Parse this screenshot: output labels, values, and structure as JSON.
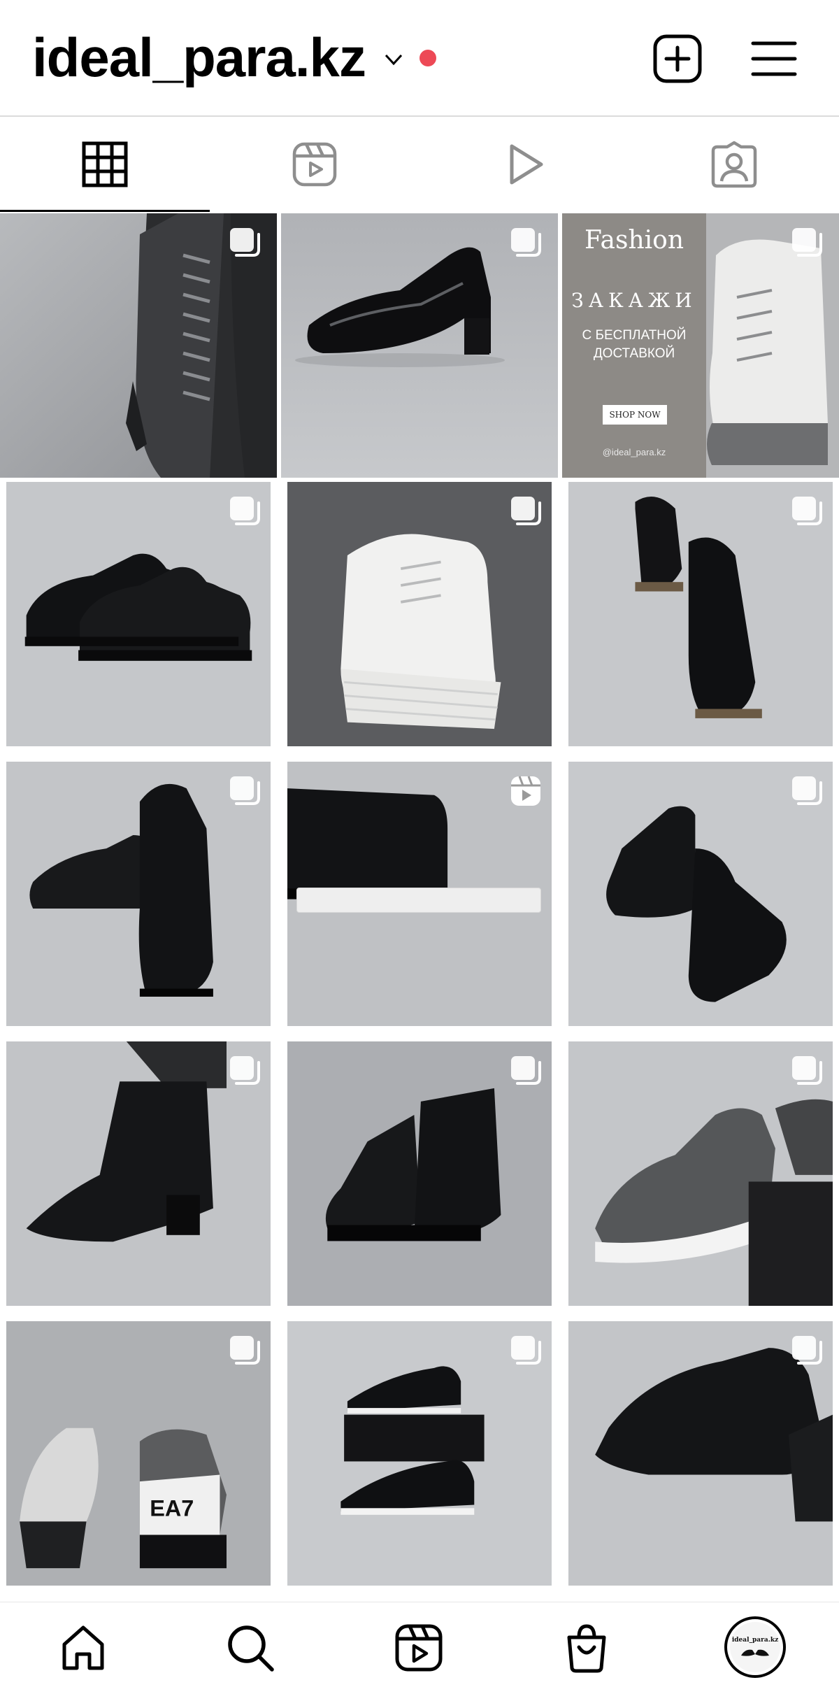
{
  "profile": {
    "username": "ideal_para.kz",
    "has_notification_dot": true,
    "notification_color": "#ed4956"
  },
  "header": {
    "icons": [
      "chevron-down-icon",
      "create-post-icon",
      "menu-icon"
    ]
  },
  "tabs": [
    {
      "name": "posts",
      "icon": "grid-icon",
      "active": true
    },
    {
      "name": "reels",
      "icon": "reels-icon",
      "active": false
    },
    {
      "name": "videos",
      "icon": "play-icon",
      "active": false
    },
    {
      "name": "tagged",
      "icon": "tagged-user-icon",
      "active": false
    }
  ],
  "grid": {
    "posts": [
      {
        "type": "carousel",
        "subject": "black leather lace-up heeled boots"
      },
      {
        "type": "carousel",
        "subject": "black patent leather heeled pumps"
      },
      {
        "type": "carousel",
        "subject": "promo banner with white platform boots",
        "promo": {
          "title": "Fashion",
          "headline": "ЗАКАЖИ",
          "subtitle": "С БЕСПЛАТНОЙ\nДОСТАВКОЙ",
          "button": "SHOP NOW",
          "handle": "@ideal_para.kz"
        }
      },
      {
        "type": "carousel",
        "subject": "black leather sneakers"
      },
      {
        "type": "carousel",
        "subject": "white platform sneakers"
      },
      {
        "type": "carousel",
        "subject": "black leather loafers"
      },
      {
        "type": "carousel",
        "subject": "black leather derby shoes"
      },
      {
        "type": "reel",
        "subject": "black leather slip-on shoes"
      },
      {
        "type": "carousel",
        "subject": "black leather zip ankle boots"
      },
      {
        "type": "carousel",
        "subject": "black heeled ankle boots"
      },
      {
        "type": "carousel",
        "subject": "black chelsea boots"
      },
      {
        "type": "carousel",
        "subject": "grey knit sneakers"
      },
      {
        "type": "carousel",
        "subject": "EA7 sneakers",
        "print": "EA7"
      },
      {
        "type": "carousel",
        "subject": "black BOSS sneakers on box"
      },
      {
        "type": "carousel",
        "subject": "black leather heeled loafers"
      }
    ]
  },
  "bottom_nav": [
    {
      "name": "home",
      "icon": "home-icon"
    },
    {
      "name": "search",
      "icon": "search-icon"
    },
    {
      "name": "reels",
      "icon": "reels-icon"
    },
    {
      "name": "shop",
      "icon": "shopping-bag-icon"
    },
    {
      "name": "profile",
      "icon": "avatar",
      "avatar_text": "ideal_para.kz"
    }
  ],
  "colors": {
    "text": "#000000",
    "divider": "#dbdbdb",
    "tile_bg": "#c9cbcf"
  }
}
